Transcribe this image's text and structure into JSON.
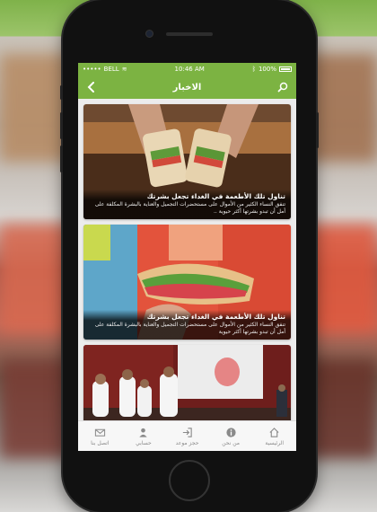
{
  "status_bar": {
    "carrier": "BELL",
    "time": "10:46 AM",
    "battery": "100%"
  },
  "header": {
    "title": "الاخبار"
  },
  "news": [
    {
      "title": "تناول تلك الأطعمة في الغداء تجعل بشرتك",
      "text": "تنفق النساء الكثير من الأموال على مستحضرات التجميل والعناية بالبشرة المكلفة على أمل أن تبدو بشرتها أكثر حيوية .."
    },
    {
      "title": "تناول تلك الأطعمة في الغداء تجعل بشرتك",
      "text": "تنفق النساء الكثير من الأموال على مستحضرات التجميل والعناية بالبشرة المكلفة على أمل أن تبدو بشرتها أكثر حيوية"
    }
  ],
  "tabs": [
    {
      "label": "الرئيسية",
      "icon": "home-icon"
    },
    {
      "label": "من نحن",
      "icon": "info-icon"
    },
    {
      "label": "حجز موعد",
      "icon": "login-icon"
    },
    {
      "label": "حسابي",
      "icon": "account-icon"
    },
    {
      "label": "اتصل بنا",
      "icon": "mail-icon"
    }
  ],
  "colors": {
    "accent": "#7cb342",
    "tab_icon": "#8a8a8a",
    "background": "#ececec"
  }
}
